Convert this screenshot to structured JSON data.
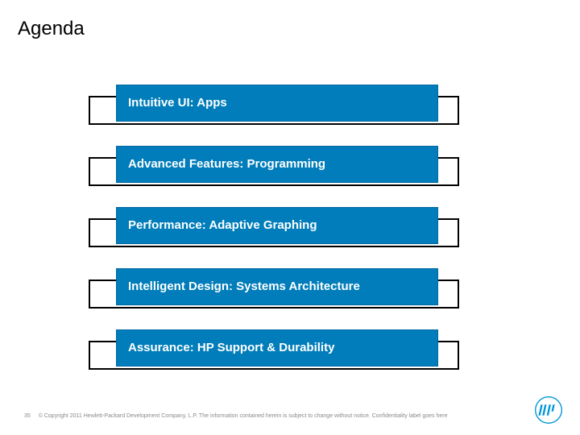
{
  "title": "Agenda",
  "items": [
    {
      "label": "Intuitive UI: Apps"
    },
    {
      "label": "Advanced Features: Programming"
    },
    {
      "label": "Performance: Adaptive Graphing"
    },
    {
      "label": "Intelligent Design: Systems Architecture"
    },
    {
      "label": "Assurance: HP Support & Durability"
    }
  ],
  "footer": {
    "page": "35",
    "copyright": "© Copyright 2011 Hewlett-Packard Development Company, L.P.  The information contained herein is subject to change without notice. Confidentiality label goes here"
  }
}
